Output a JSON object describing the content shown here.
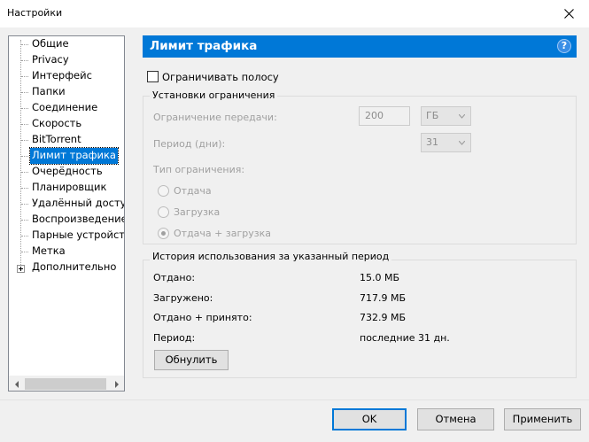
{
  "window": {
    "title": "Настройки"
  },
  "tree": {
    "items": [
      "Общие",
      "Privacy",
      "Интерфейс",
      "Папки",
      "Соединение",
      "Скорость",
      "BitTorrent",
      "Лимит трафика",
      "Очерёдность",
      "Планировщик",
      "Удалённый доступ",
      "Воспроизведение",
      "Парные устройства",
      "Метка",
      "Дополнительно"
    ],
    "selected": "Лимит трафика"
  },
  "panel": {
    "title": "Лимит трафика",
    "help": "?",
    "limit_checkbox_label": "Ограничивать полосу",
    "limit_checked": false
  },
  "limit_settings": {
    "group_title": "Установки ограничения",
    "transfer_limit_label": "Ограничение передачи:",
    "transfer_limit_value": "200",
    "transfer_limit_unit": "ГБ",
    "period_label": "Период (дни):",
    "period_value": "31",
    "limit_type_label": "Тип ограничения:",
    "options": [
      "Отдача",
      "Загрузка",
      "Отдача + загрузка"
    ],
    "selected_option": "Отдача + загрузка"
  },
  "history": {
    "group_title": "История использования за указанный период",
    "rows": [
      {
        "label": "Отдано:",
        "value": "15.0 МБ"
      },
      {
        "label": "Загружено:",
        "value": "717.9 МБ"
      },
      {
        "label": "Отдано + принято:",
        "value": "732.9 МБ"
      },
      {
        "label": "Период:",
        "value": "последние 31 дн."
      }
    ],
    "reset_label": "Обнулить"
  },
  "footer": {
    "ok_label": "OK",
    "cancel_label": "Отмена",
    "apply_label": "Применить"
  }
}
